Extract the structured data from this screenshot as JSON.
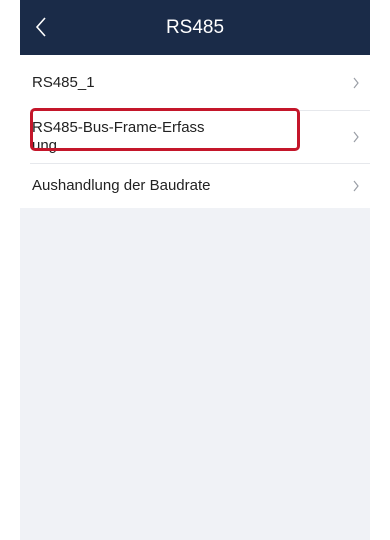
{
  "header": {
    "title": "RS485",
    "back_icon": "chevron-left-icon",
    "background": "#1a2b48"
  },
  "list": {
    "items": [
      {
        "label": "RS485_1",
        "icon": "chevron-right-icon"
      },
      {
        "label": "RS485-Bus-Frame-Erfassung",
        "icon": "chevron-right-icon"
      },
      {
        "label": "Aushandlung der Baudrate",
        "icon": "chevron-right-icon",
        "highlighted": true
      }
    ]
  },
  "colors": {
    "highlight_border": "#c4162a",
    "page_background": "#f0f2f6"
  }
}
